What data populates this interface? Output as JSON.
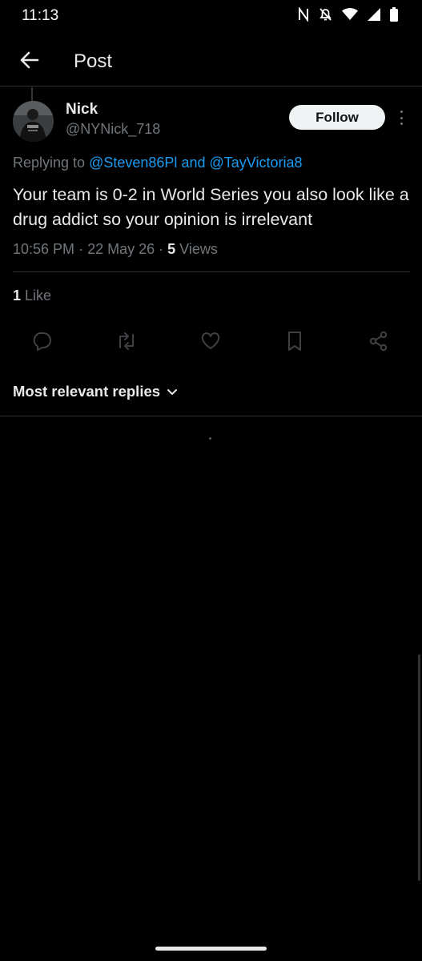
{
  "status_bar": {
    "time": "11:13",
    "icons": [
      "nfc-icon",
      "bell-off-icon",
      "wifi-icon",
      "signal-icon",
      "battery-icon"
    ]
  },
  "header": {
    "title": "Post",
    "back_icon": "arrow-left-icon"
  },
  "post": {
    "author": {
      "name": "Nick",
      "handle": "@NYNick_718"
    },
    "follow_label": "Follow",
    "replying": {
      "prefix": "Replying to",
      "mention1": "@Steven86Pl",
      "joiner": "and",
      "mention2": "@TayVictoria8"
    },
    "text": "Your team is 0-2 in World Series you also look like a drug addict so your opinion is irrelevant",
    "time": "10:56 PM",
    "date": "22 May 26",
    "views_count": "5",
    "views_label": "Views",
    "likes_count": "1",
    "likes_label": "Like"
  },
  "actions": [
    "reply-icon",
    "repost-icon",
    "like-icon",
    "bookmark-icon",
    "share-icon"
  ],
  "replies_sort": {
    "label": "Most relevant replies"
  },
  "colors": {
    "background": "#000000",
    "text": "#e7e9ea",
    "secondary": "#71767b",
    "accent": "#1d9bf0",
    "divider": "#2f3336"
  }
}
